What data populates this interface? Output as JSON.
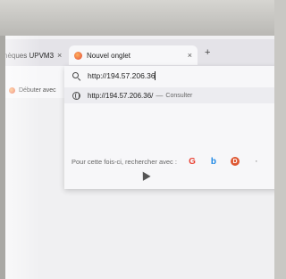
{
  "tabs": [
    {
      "label": "hèques UPVM3",
      "active": false
    },
    {
      "label": "Nouvel onglet",
      "active": true
    }
  ],
  "tab_close_glyph": "×",
  "new_tab_glyph": "+",
  "bookmarks": [
    {
      "label": "Débuter avec"
    }
  ],
  "urlbar": {
    "value": "http://194.57.206.36"
  },
  "suggestion": {
    "url": "http://194.57.206.36/",
    "separator": "—",
    "action": "Consulter"
  },
  "search_engines": {
    "label": "Pour cette fois-ci, rechercher avec :",
    "engines": [
      {
        "name": "google-icon",
        "glyph": "G",
        "color": "#ea4335"
      },
      {
        "name": "bing-icon",
        "glyph": "b",
        "color": "#1e88e5"
      },
      {
        "name": "duckduckgo-icon",
        "glyph": "D",
        "color": "#de5833"
      },
      {
        "name": "more-engines-icon",
        "glyph": "·",
        "color": "#999999"
      }
    ]
  },
  "colors": {
    "tabbar_bg": "#e4e3e8",
    "toolbar_bg": "#f7f7f9",
    "suggestion_highlight": "#ececf0"
  }
}
